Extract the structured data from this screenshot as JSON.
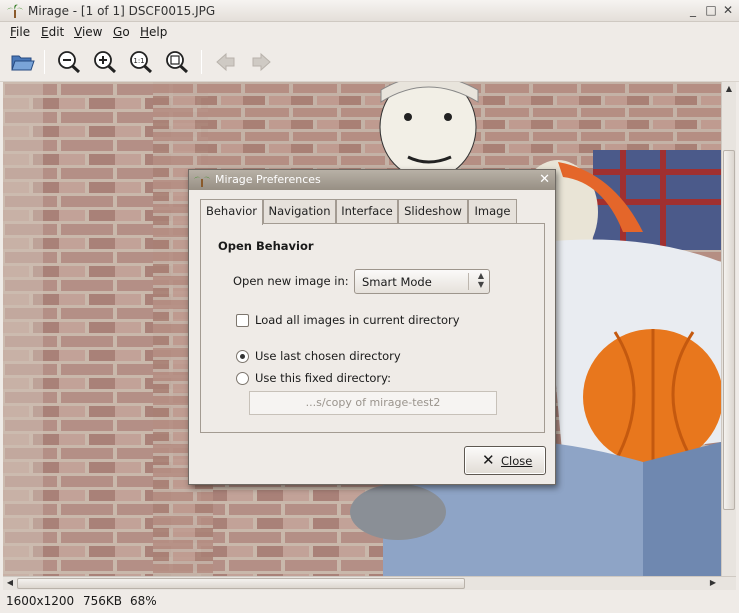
{
  "window": {
    "title": "Mirage - [1 of 1] DSCF0015.JPG",
    "controls": [
      "_",
      "□",
      "✕"
    ]
  },
  "menu": [
    {
      "label": "File",
      "mnemonic": "F",
      "rest": "ile"
    },
    {
      "label": "Edit",
      "mnemonic": "E",
      "rest": "dit"
    },
    {
      "label": "View",
      "mnemonic": "V",
      "rest": "iew"
    },
    {
      "label": "Go",
      "mnemonic": "G",
      "rest": "o"
    },
    {
      "label": "Help",
      "mnemonic": "H",
      "rest": "elp"
    }
  ],
  "toolbar": [
    "open-folder-icon",
    "zoom-out-icon",
    "zoom-in-icon",
    "zoom-100-icon",
    "zoom-fit-icon",
    "previous-arrow-icon",
    "next-arrow-icon"
  ],
  "status": {
    "dimensions": "1600x1200",
    "filesize": "756KB",
    "zoom": "68%"
  },
  "dialog": {
    "title": "Mirage Preferences",
    "tabs": [
      "Behavior",
      "Navigation",
      "Interface",
      "Slideshow",
      "Image"
    ],
    "active_tab": "Behavior",
    "section_title": "Open Behavior",
    "open_new_label": "Open new image in:",
    "open_new_value": "Smart Mode",
    "load_all_label": "Load all images in current directory",
    "load_all_checked": false,
    "use_last_label": "Use last chosen directory",
    "use_last_checked": true,
    "use_fixed_label": "Use this fixed directory:",
    "use_fixed_checked": false,
    "fixed_dir_value": "...s/copy of mirage-test2",
    "close_label": "Close"
  },
  "colors": {
    "dialog_title_bg": "#a8a095",
    "window_bg": "#efebe7"
  }
}
